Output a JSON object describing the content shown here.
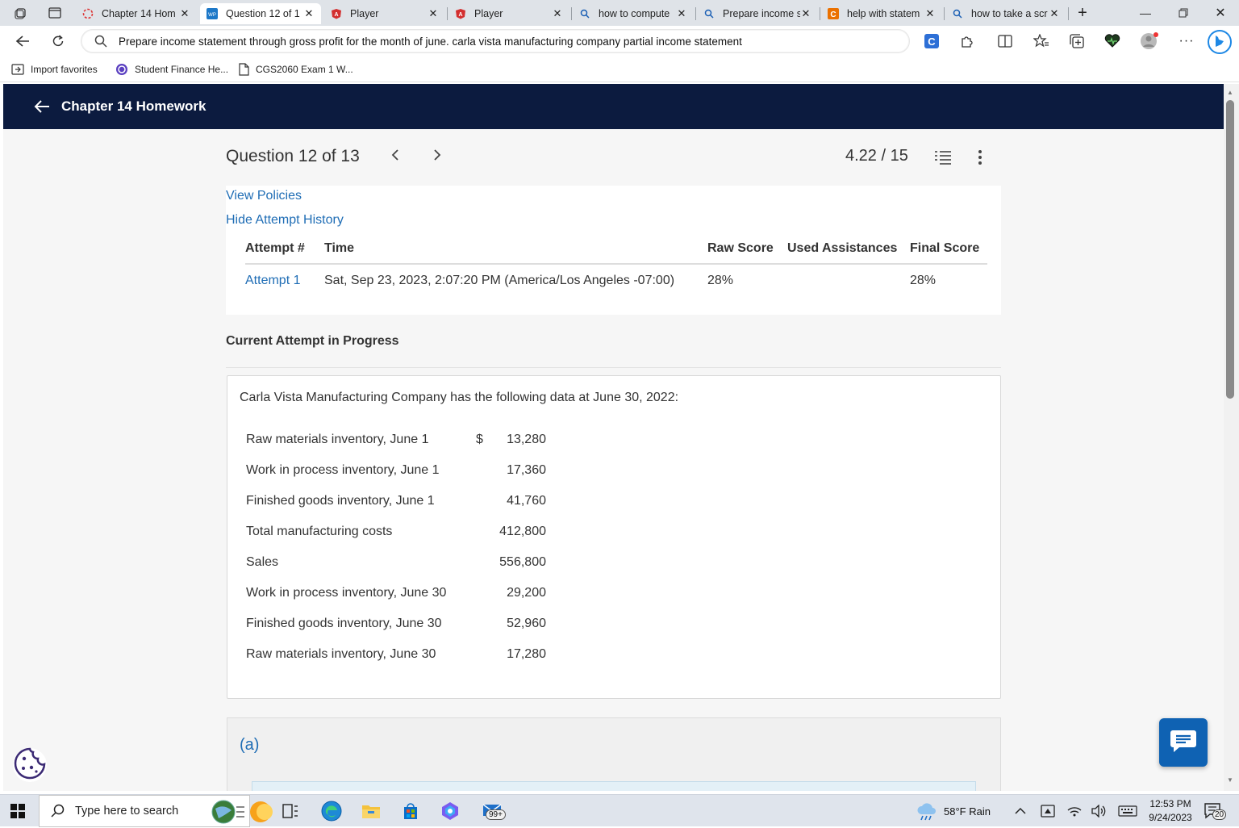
{
  "browser": {
    "tabs": [
      {
        "title": "Chapter 14 Hom",
        "icon": "loading-icon",
        "active": false
      },
      {
        "title": "Question 12 of 1",
        "icon": "wileyplus-icon",
        "active": true
      },
      {
        "title": "Player",
        "icon": "player-icon",
        "active": false
      },
      {
        "title": "Player",
        "icon": "player-icon",
        "active": false
      },
      {
        "title": "how to compute",
        "icon": "search-icon",
        "active": false
      },
      {
        "title": "Prepare income s",
        "icon": "search-icon",
        "active": false
      },
      {
        "title": "help with statem",
        "icon": "chegg-icon",
        "active": false
      },
      {
        "title": "how to take a scr",
        "icon": "search-icon",
        "active": false
      }
    ],
    "address": "Prepare income statement through gross profit for the month of june. carla vista manufacturing company partial income statement",
    "favorites": [
      {
        "label": "Import favorites",
        "icon": "import-icon"
      },
      {
        "label": "Student Finance He...",
        "icon": "finance-icon"
      },
      {
        "label": "CGS2060 Exam 1 W...",
        "icon": "document-icon"
      }
    ],
    "accent": "#0c1b3f"
  },
  "page": {
    "header_title": "Chapter 14 Homework",
    "question_label": "Question 12 of 13",
    "score": "4.22 / 15",
    "view_policies": "View Policies",
    "hide_attempt_history": "Hide Attempt History",
    "attempt_table": {
      "headers": [
        "Attempt #",
        "Time",
        "Raw Score",
        "Used Assistances",
        "Final Score"
      ],
      "rows": [
        [
          "Attempt 1",
          "Sat, Sep 23, 2023, 2:07:20 PM (America/Los Angeles -07:00)",
          "28%",
          "",
          "28%"
        ]
      ]
    },
    "current_attempt": "Current Attempt in Progress",
    "question_intro": "Carla Vista Manufacturing Company has the following data at June 30, 2022:",
    "currency_symbol": "$",
    "data_rows": [
      {
        "label": "Raw materials inventory, June 1",
        "value": "13,280"
      },
      {
        "label": "Work in process inventory, June 1",
        "value": "17,360"
      },
      {
        "label": "Finished goods inventory, June 1",
        "value": "41,760"
      },
      {
        "label": "Total manufacturing costs",
        "value": "412,800"
      },
      {
        "label": "Sales",
        "value": "556,800"
      },
      {
        "label": "Work in process inventory, June 30",
        "value": "29,200"
      },
      {
        "label": "Finished goods inventory, June 30",
        "value": "52,960"
      },
      {
        "label": "Raw materials inventory, June 30",
        "value": "17,280"
      }
    ],
    "part_label": "(a)"
  },
  "taskbar": {
    "search_placeholder": "Type here to search",
    "mail_badge": "99+",
    "weather": "58°F  Rain",
    "time": "12:53 PM",
    "date": "9/24/2023",
    "notification_count": "20"
  }
}
